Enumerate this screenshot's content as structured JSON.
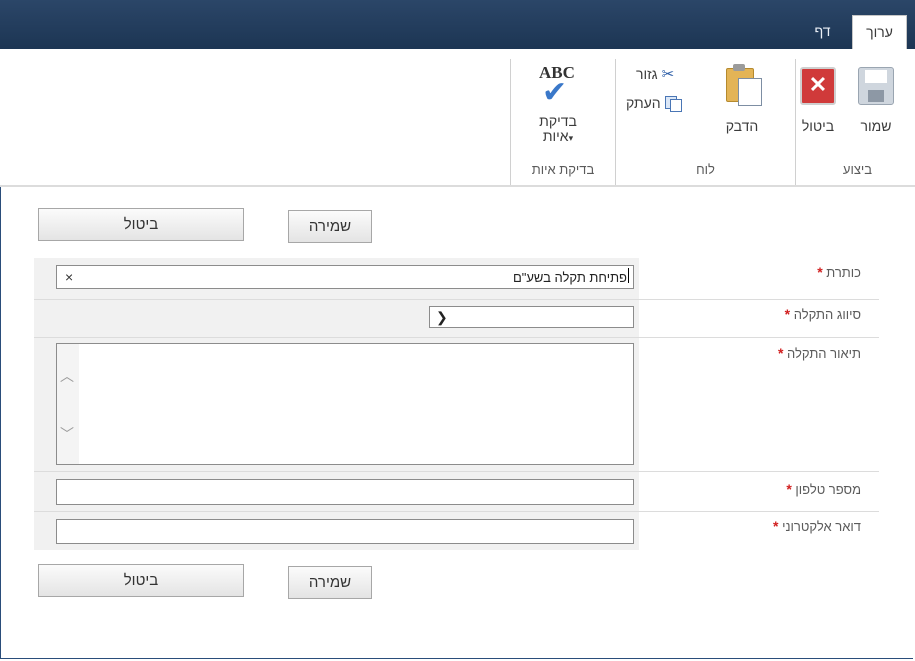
{
  "tabs": {
    "edit": "ערוך",
    "page": "דף"
  },
  "ribbon": {
    "groups": [
      {
        "label": "ביצוע"
      },
      {
        "label": "לוח"
      },
      {
        "label": "בדיקת איות"
      }
    ],
    "commit": {
      "save": "שמור",
      "cancel": "ביטול"
    },
    "clipboard": {
      "paste": "הדבק",
      "cut": "גזור",
      "copy": "העתק"
    },
    "spelling": {
      "button_line1": "בדיקת",
      "button_line2": "איות",
      "icon_text": "ABC"
    }
  },
  "buttons": {
    "save": "שמירה",
    "cancel": "ביטול"
  },
  "form": {
    "fields": [
      {
        "label": "כותרת",
        "required": "*",
        "value": "פתיחת תקלה בשע\"ם",
        "clear": "×"
      },
      {
        "label": "סיווג התקלה",
        "required": "*",
        "value": ""
      },
      {
        "label": "תיאור התקלה",
        "required": "*",
        "value": ""
      },
      {
        "label": "מספר טלפון",
        "required": "*",
        "value": ""
      },
      {
        "label": "דואר אלקטרוני",
        "required": "*",
        "value": ""
      }
    ]
  },
  "icons": {
    "save": "save-icon",
    "cancel": "cancel-icon",
    "paste": "paste-icon",
    "cut": "scissors-icon",
    "copy": "copy-icon",
    "spelling": "spell-check-icon"
  },
  "colors": {
    "topbar": "#1c3553",
    "required": "#d11f1f",
    "form_bg": "#f1f1f1"
  }
}
